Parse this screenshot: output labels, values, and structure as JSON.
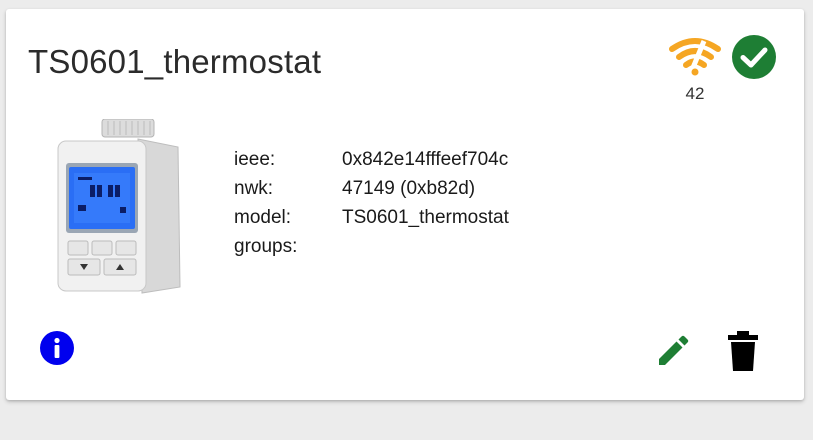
{
  "device": {
    "title": "TS0601_thermostat",
    "lqi": "42",
    "image_alt": "thermostat-radiator-valve-image",
    "details": [
      {
        "key": "ieee:",
        "value": "0x842e14fffeef704c"
      },
      {
        "key": "nwk:",
        "value": "47149 (0xb82d)"
      },
      {
        "key": "model:",
        "value": "TS0601_thermostat"
      },
      {
        "key": "groups:",
        "value": ""
      }
    ]
  },
  "icons": {
    "signal": "wifi-signal-icon",
    "status": "check-circle-icon",
    "info": "info-icon",
    "edit": "pencil-icon",
    "delete": "trash-icon"
  },
  "colors": {
    "signal": "#f5a623",
    "status": "#1e7e34",
    "info": "#0000ee",
    "edit": "#1e7e34",
    "delete": "#000000"
  }
}
